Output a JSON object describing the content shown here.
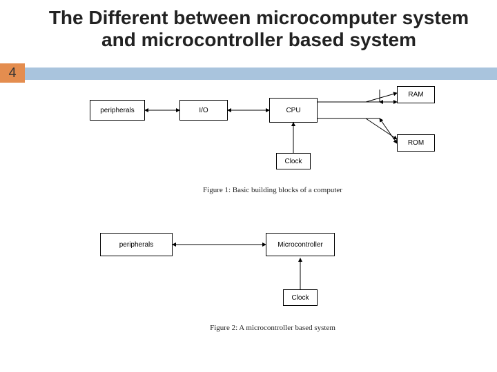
{
  "page_number": "4",
  "title": "The Different between microcomputer system and microcontroller based system",
  "figure1": {
    "caption": "Figure 1: Basic building blocks of a computer",
    "blocks": {
      "peripherals": "peripherals",
      "io": "I/O",
      "cpu": "CPU",
      "clock": "Clock",
      "ram": "RAM",
      "rom": "ROM"
    }
  },
  "figure2": {
    "caption": "Figure 2: A microcontroller based system",
    "blocks": {
      "peripherals": "peripherals",
      "microcontroller": "Microcontroller",
      "clock": "Clock"
    }
  }
}
